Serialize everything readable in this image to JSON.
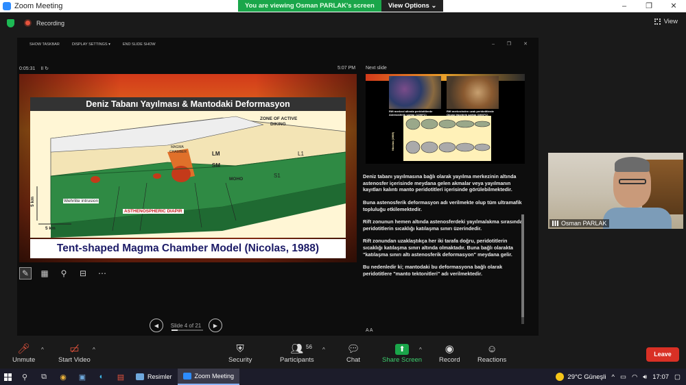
{
  "window": {
    "title": "Zoom Meeting",
    "controls": [
      "–",
      "❐",
      "✕"
    ]
  },
  "banner": {
    "viewing": "You are viewing Osman PARLAK's screen",
    "view_options": "View Options ⌄"
  },
  "topbar": {
    "recording": "Recording",
    "view": "View"
  },
  "presenter": {
    "toolbar": {
      "show_taskbar": "SHOW TASKBAR",
      "display_settings": "DISPLAY SETTINGS ▾",
      "end_slide_show": "END SLIDE SHOW"
    },
    "timer": "0:05:31",
    "timer_controls": "II  ↻",
    "clock": "5:07 PM",
    "next_slide_label": "Next slide",
    "slide": {
      "title": "Deniz Tabanı Yayılması & Mantodaki Deformasyon",
      "caption": "Tent-shaped Magma Chamber Model (Nicolas, 1988)",
      "figure_labels": {
        "zone": "ZONE OF ACTIVE",
        "diking": "DIKING",
        "magma": "MAGMA",
        "chamber": "CHAMBER",
        "lm": "LM",
        "sm": "SM",
        "moho": "MOHO",
        "l1": "L1",
        "s1": "S1",
        "wehrlite": "Wehrlite intrusion",
        "diapir": "ASTHENOSPHERIC DIAPIR",
        "km_v": "5 km",
        "km_h": "5 km"
      }
    },
    "next_slide": {
      "cap1": "Rift merkezi altında peridotitlerde Astenosferik şartlar (1250°C)",
      "cap2": "Rift merkezinden uzak peridotitlerde Okyan litosferik şartlar (1000°C)",
      "side": "Nicolas (1989)"
    },
    "notes": [
      "Deniz tabanı yayılmasına bağlı olarak yayılma merkezinin altında astenosfer içerisinde meydana gelen akmalar veya yayılmanın kayıtları kalıntı manto peridotitleri içerisinde görülebilmektedir.",
      "Buna astenosferik deformasyon adı verilmekte olup tüm ultramafik topluluğu etkilemektedir.",
      "Rift zonunun hemen altında astenosferdeki yayılma/akma sırasında peridotitlerin sıcaklığı katılaşma sınırı üzerindedir.",
      "Rift zonundan uzaklaştıkça her iki tarafa doğru, peridotitlerin sıcaklığı katılaşma sınırı altında olmaktadır. Buna bağlı olarakta \"katılaşma sınırı altı astenosferik deformasyon\" meydana gelir.",
      "Bu nedenledir ki; mantodaki bu deformasyona bağlı olarak peridotitlere \"manto tektonitleri\" adı verilmektedir."
    ],
    "font_ctrl": "A  A",
    "slide_count": "Slide 4 of 21",
    "progress": 0.19
  },
  "participant": {
    "name": "Osman PARLAK"
  },
  "toolbar": {
    "unmute": "Unmute",
    "start_video": "Start Video",
    "security": "Security",
    "participants": "Participants",
    "participants_count": "56",
    "chat": "Chat",
    "share_screen": "Share Screen",
    "record": "Record",
    "reactions": "Reactions",
    "leave": "Leave"
  },
  "taskbar": {
    "apps": [
      "Resimler",
      "Zoom Meeting"
    ],
    "weather": "29°C  Güneşli",
    "time": "17:07"
  },
  "colors": {
    "share_green": "#1aa64a",
    "leave_red": "#d93025",
    "slide_title_bg": "#333333",
    "caption_text": "#1b1a66"
  }
}
